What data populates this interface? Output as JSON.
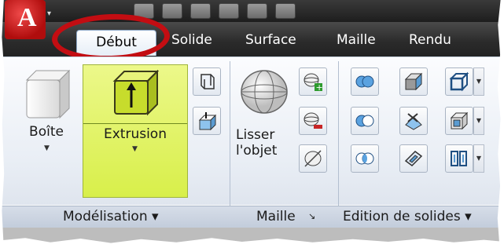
{
  "tabs": {
    "debut": "Début",
    "solide": "Solide",
    "surface": "Surface",
    "maille": "Maille",
    "rendu": "Rendu"
  },
  "logo": {
    "letter": "A"
  },
  "buttons": {
    "boite": "Boîte",
    "extrusion": "Extrusion",
    "lisser_line1": "Lisser",
    "lisser_line2": "l'objet"
  },
  "panels": {
    "modelisation": "Modélisation ▾",
    "maille": "Maille",
    "maille_launcher": "↘",
    "edition": "Edition de solides ▾"
  },
  "colors": {
    "annotation": "#c30d12",
    "highlight": "#d8ef4a",
    "logo": "#d21b1b"
  }
}
